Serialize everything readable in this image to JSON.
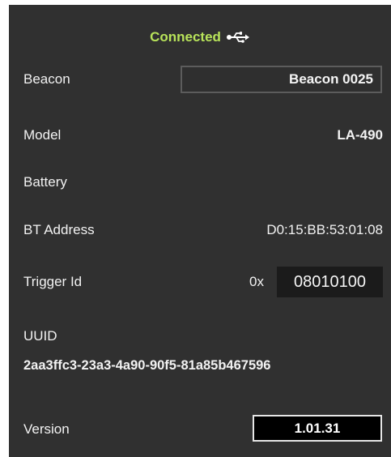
{
  "status": {
    "text": "Connected",
    "icon": "usb-icon",
    "color": "#b8e35a"
  },
  "beacon": {
    "label": "Beacon",
    "value": "Beacon 0025"
  },
  "model": {
    "label": "Model",
    "value": "LA-490"
  },
  "battery": {
    "label": "Battery"
  },
  "bt_address": {
    "label": "BT Address",
    "value": "D0:15:BB:53:01:08"
  },
  "trigger_id": {
    "label": "Trigger Id",
    "prefix": "0x",
    "value": "08010100"
  },
  "uuid": {
    "label": "UUID",
    "value": "2aa3ffc3-23a3-4a90-90f5-81a85b467596"
  },
  "version": {
    "label": "Version",
    "value": "1.01.31"
  },
  "colors": {
    "panel_background": "#303030",
    "text": "#f2f2f2",
    "status_accent": "#b8e35a"
  }
}
